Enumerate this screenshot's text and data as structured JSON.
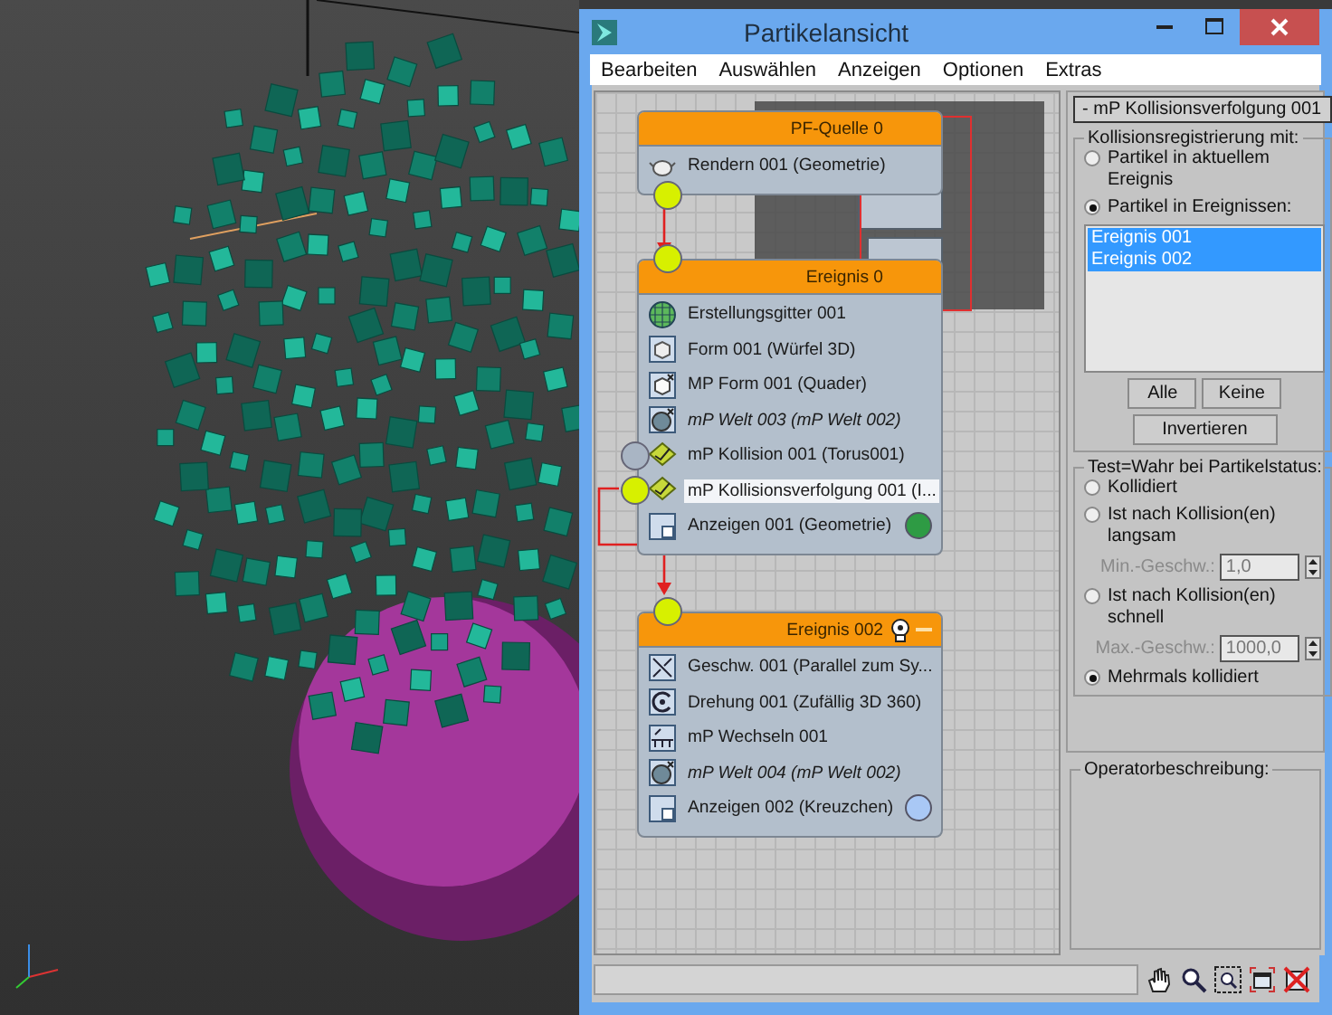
{
  "window": {
    "title": "Partikelansicht"
  },
  "menu": [
    "Bearbeiten",
    "Auswählen",
    "Anzeigen",
    "Optionen",
    "Extras"
  ],
  "graph": {
    "nodes": [
      {
        "title": "PF-Quelle 0",
        "kind": "source",
        "controls": false,
        "operators": [
          {
            "label": "Rendern 001 (Geometrie)",
            "kind": "render",
            "italic": false,
            "selected": false
          }
        ]
      },
      {
        "title": "Ereignis 0",
        "kind": "event",
        "controls": false,
        "operators": [
          {
            "label": "Erstellungsgitter 001",
            "kind": "grid",
            "italic": false,
            "selected": false
          },
          {
            "label": "Form 001 (Würfel 3D)",
            "kind": "shape",
            "italic": false,
            "selected": false
          },
          {
            "label": "MP Form 001 (Quader)",
            "kind": "mpshape",
            "italic": false,
            "selected": false
          },
          {
            "label": "mP Welt 003 (mP Welt 002)",
            "kind": "world",
            "italic": true,
            "selected": false
          },
          {
            "label": "mP Kollision 001 (Torus001)",
            "kind": "test",
            "italic": false,
            "selected": false,
            "connected": false
          },
          {
            "label": "mP Kollisionsverfolgung 001 (I...",
            "kind": "test",
            "italic": false,
            "selected": true,
            "connected": true
          },
          {
            "label": "Anzeigen 001 (Geometrie)",
            "kind": "display",
            "italic": false,
            "selected": false,
            "color": "#2e9b44"
          }
        ]
      },
      {
        "title": "Ereignis 002",
        "kind": "event",
        "controls": true,
        "operators": [
          {
            "label": "Geschw. 001 (Parallel zum Sy...",
            "kind": "speed",
            "italic": false,
            "selected": false
          },
          {
            "label": "Drehung 001 (Zufällig 3D 360)",
            "kind": "rotation",
            "italic": false,
            "selected": false
          },
          {
            "label": "mP Wechseln  001",
            "kind": "switch",
            "italic": false,
            "selected": false
          },
          {
            "label": "mP Welt 004 (mP Welt 002)",
            "kind": "world",
            "italic": true,
            "selected": false
          },
          {
            "label": "Anzeigen 002 (Kreuzchen)",
            "kind": "display",
            "italic": false,
            "selected": false,
            "color": "#a9c8f5"
          }
        ]
      }
    ]
  },
  "panel": {
    "rollout": "- mP Kollisionsverfolgung 001",
    "groups": [
      {
        "title": "Kollisionsregistrierung mit:",
        "items": [
          {
            "kind": "radio",
            "label": "Partikel in aktuellem Ereignis",
            "selected": false
          },
          {
            "kind": "radio",
            "label": "Partikel in Ereignissen:",
            "selected": true
          },
          {
            "kind": "list",
            "items": [
              {
                "label": "Ereignis 001",
                "selected": true
              },
              {
                "label": "Ereignis 002",
                "selected": true
              }
            ]
          },
          {
            "kind": "buttons",
            "buttons": [
              "Alle",
              "Keine"
            ]
          },
          {
            "kind": "buttons",
            "buttons": [
              "Invertieren"
            ]
          }
        ]
      },
      {
        "title": "Test=Wahr bei Partikelstatus:",
        "items": [
          {
            "kind": "radio",
            "label": "Kollidiert",
            "selected": false
          },
          {
            "kind": "radio",
            "label": "Ist nach Kollision(en) langsam",
            "selected": false
          },
          {
            "kind": "spinner",
            "label": "Min.-Geschw.:",
            "value": "1,0",
            "disabled": true
          },
          {
            "kind": "radio",
            "label": "Ist nach Kollision(en) schnell",
            "selected": false
          },
          {
            "kind": "spinner",
            "label": "Max.-Geschw.:",
            "value": "1000,0",
            "disabled": true
          },
          {
            "kind": "radio",
            "label": "Mehrmals kollidiert",
            "selected": true
          }
        ]
      }
    ],
    "description": {
      "title": "Operatorbeschreibung:"
    }
  }
}
